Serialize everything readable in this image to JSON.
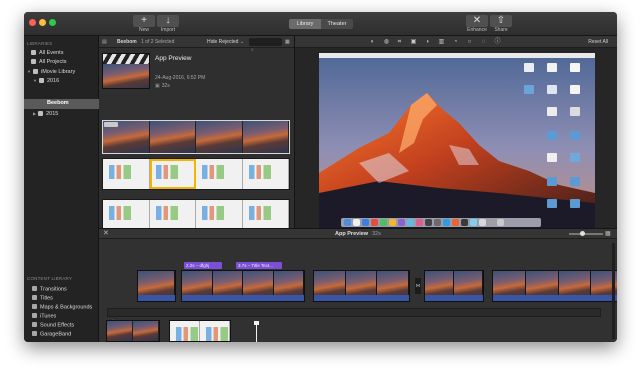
{
  "toolbar": {
    "new_label": "New",
    "import_label": "Import",
    "tabs": [
      {
        "label": "Library"
      },
      {
        "label": "Theater"
      }
    ],
    "enhance_label": "Enhance",
    "share_label": "Share"
  },
  "sidebar": {
    "libraries_header": "LIBRARIES",
    "items": [
      {
        "label": "All Events"
      },
      {
        "label": "All Projects"
      },
      {
        "label": "iMovie Library"
      },
      {
        "label": "2016"
      },
      {
        "label": "Beebom"
      },
      {
        "label": "2015"
      }
    ],
    "content_library_header": "CONTENT LIBRARY",
    "content_items": [
      {
        "label": "Transitions"
      },
      {
        "label": "Titles"
      },
      {
        "label": "Maps & Backgrounds"
      },
      {
        "label": "iTunes"
      },
      {
        "label": "Sound Effects"
      },
      {
        "label": "GarageBand"
      }
    ]
  },
  "browser": {
    "event_name": "Beebom",
    "selection_status": "1 of 2 Selected",
    "filter": "Hide Rejected",
    "project": {
      "title": "App Preview",
      "date": "24-Aug-2016, 6:52 PM",
      "duration": "32s"
    }
  },
  "viewer": {
    "reset_label": "Reset All"
  },
  "timeline": {
    "project_title": "App Preview",
    "duration": "32s",
    "title_clips": [
      {
        "label": "2.2s – dfghj"
      },
      {
        "label": "3.7s – Title Text..."
      }
    ]
  }
}
